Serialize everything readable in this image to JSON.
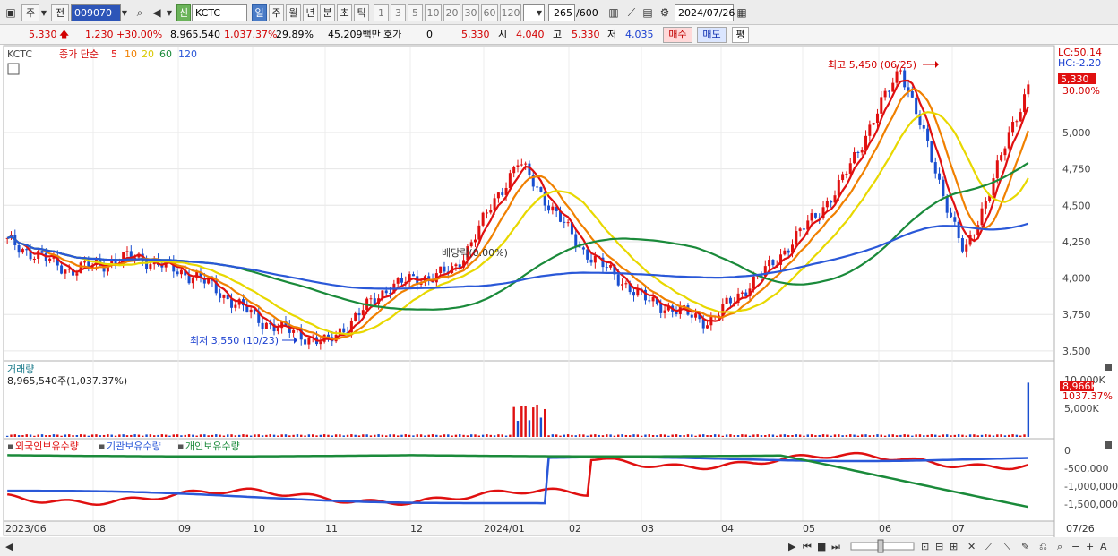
{
  "toolbar": {
    "type_label": "주",
    "prev_label": "전",
    "code": "009070",
    "new_badge": "신",
    "name": "KCTC",
    "periods": [
      "일",
      "주",
      "월",
      "년",
      "분",
      "초",
      "틱"
    ],
    "period_selected": "일",
    "minute_steps": [
      "1",
      "3",
      "5",
      "10",
      "20",
      "30",
      "60",
      "120"
    ],
    "count_value": "265",
    "count_max": "/600",
    "date_value": "2024/07/26"
  },
  "quote": {
    "price": "5,330",
    "change": "1,230",
    "change_pct": "+30.00%",
    "volume": "8,965,540",
    "volume_pct": "1,037.37%",
    "turnover": "29.89%",
    "amount": "45,209백만",
    "hoga_label": "호가",
    "hoga_value": "0",
    "hoga_price": "5,330",
    "open_label": "시",
    "open_value": "4,040",
    "high_label": "고",
    "high_value": "5,330",
    "low_label": "저",
    "low_value": "4,035",
    "buy_label": "매수",
    "sell_label": "매도",
    "eval_label": "평"
  },
  "price_panel": {
    "code_tag": "KCTC",
    "legend_title": "종가 단순",
    "ma_periods": [
      "5",
      "10",
      "20",
      "60",
      "120"
    ],
    "ma_colors": [
      "#e01010",
      "#f08000",
      "#e8d800",
      "#1a8a3a",
      "#2a58d8"
    ],
    "lc_label": "LC:50.14",
    "hc_label": "HC:-2.20",
    "last_price_tag": "5,330",
    "last_pct_tag": "30.00%",
    "high_annotation": "최고 5,450 (06/25)",
    "low_annotation": "최저 3,550 (10/23)",
    "dividend_annotation": "배당락(0.00%)",
    "y_ticks": [
      "5,000",
      "4,750",
      "4,500",
      "4,250",
      "4,000",
      "3,750",
      "3,500"
    ]
  },
  "volume_panel": {
    "title": "거래량",
    "value_label": "8,965,540주(1,037.37%)",
    "y_tick": "10,000K",
    "y_tick2": "5,000K",
    "last_tag": "8,966K",
    "last_pct": "1037.37%"
  },
  "holding_panel": {
    "legend": [
      "외국인보유수량",
      "기관보유수량",
      "개인보유수량"
    ],
    "colors": [
      "#e01010",
      "#2a58d8",
      "#1a8a3a"
    ],
    "y_ticks": [
      "0",
      "-500,000",
      "-1,000,000",
      "-1,500,000"
    ]
  },
  "x_axis": {
    "labels": [
      "2023/06",
      "08",
      "09",
      "10",
      "11",
      "12",
      "2024/01",
      "02",
      "03",
      "04",
      "05",
      "06",
      "07"
    ],
    "right_label": "07/26"
  },
  "chart_data": {
    "type": "candlestick",
    "title": "KCTC",
    "ylim": [
      3500,
      5450
    ],
    "close_series": [
      [
        "2023-06",
        4250
      ],
      [
        "2023-07",
        4050
      ],
      [
        "2023-08",
        4150
      ],
      [
        "2023-09",
        4000
      ],
      [
        "2023-10",
        3700
      ],
      [
        "2023-10-23",
        3550
      ],
      [
        "2023-11",
        3950
      ],
      [
        "2023-12",
        4050
      ],
      [
        "2024-01",
        4800
      ],
      [
        "2024-02",
        4200
      ],
      [
        "2024-03",
        3850
      ],
      [
        "2024-04",
        3700
      ],
      [
        "2024-05",
        4100
      ],
      [
        "2024-06",
        4600
      ],
      [
        "2024-06-25",
        5450
      ],
      [
        "2024-07",
        4150
      ],
      [
        "2024-07-26",
        5330
      ]
    ],
    "annotations": [
      {
        "text": "최고 5,450 (06/25)",
        "value": 5450
      },
      {
        "text": "최저 3,550 (10/23)",
        "value": 3550
      }
    ],
    "volume_last": 8965540,
    "series": [
      {
        "name": "외국인보유수량"
      },
      {
        "name": "기관보유수량"
      },
      {
        "name": "개인보유수량"
      }
    ]
  }
}
